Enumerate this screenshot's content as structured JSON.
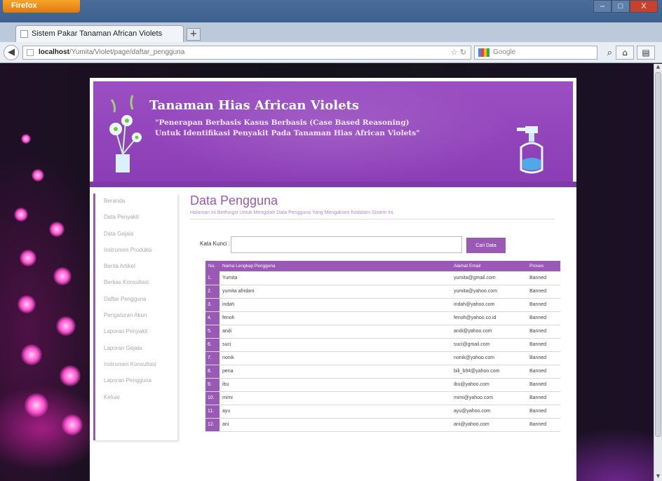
{
  "browser": {
    "app_button": "Firefox",
    "tab_title": "Sistem Pakar Tanaman African Violets",
    "new_tab": "+",
    "url_host": "localhost",
    "url_path": "/Yumita/Violet/page/daftar_pengguna",
    "search_placeholder": "Google",
    "window_min": "–",
    "window_max": "□",
    "window_close": "X"
  },
  "header": {
    "title": "Tanaman Hias African Violets",
    "subtitle_line1": "\"Penerapan Berbasis Kasus Berbasis (Case Based Reasoning)",
    "subtitle_line2": "Untuk Identifikasi Penyakit Pada Tanaman Hias African Violets\""
  },
  "sidebar": {
    "items": [
      {
        "label": "Beranda"
      },
      {
        "label": "Data Penyakit"
      },
      {
        "label": "Data Gejala"
      },
      {
        "label": "Instrumen Produksi"
      },
      {
        "label": "Berita Artikel"
      },
      {
        "label": "Berkas Konsultasi"
      },
      {
        "label": "Daftar Pengguna"
      },
      {
        "label": "Pengaturan Akun"
      },
      {
        "label": "Laporan Penyakit"
      },
      {
        "label": "Laporan Gejala"
      },
      {
        "label": "Instrumen Konsultasi"
      },
      {
        "label": "Laporan Pengguna"
      },
      {
        "label": "Keluar"
      }
    ]
  },
  "main": {
    "title": "Data Pengguna",
    "description": "Halaman ini Berfungsi Untuk Mengolah Data Pengguna Yang Mengakses Kedalam Sistem Ini.",
    "search_label": "Kata Kunci :",
    "search_value": "",
    "search_button": "Cari Data",
    "columns": [
      "No.",
      "Nama Lengkap Pengguna",
      "Alamat Email",
      "Proses"
    ],
    "rows": [
      {
        "no": "1.",
        "name": "Yumita",
        "email": "yumita@gmail.com",
        "action": "Banned"
      },
      {
        "no": "2.",
        "name": "yumita afridani",
        "email": "yumita@yahoo.com",
        "action": "Banned"
      },
      {
        "no": "3.",
        "name": "indah",
        "email": "indah@yahoo.com",
        "action": "Banned"
      },
      {
        "no": "4.",
        "name": "fenoh",
        "email": "fenoh@yahoo.co.id",
        "action": "Banned"
      },
      {
        "no": "5.",
        "name": "andi",
        "email": "andi@yahoo.com",
        "action": "Banned"
      },
      {
        "no": "6.",
        "name": "suci",
        "email": "suci@gmail.com",
        "action": "Banned"
      },
      {
        "no": "7.",
        "name": "nonik",
        "email": "nonik@yahoo.com",
        "action": "Banned"
      },
      {
        "no": "8.",
        "name": "pena",
        "email": "bili_b94@yahoo.com",
        "action": "Banned"
      },
      {
        "no": "9.",
        "name": "ibu",
        "email": "ibu@yahoo.com",
        "action": "Banned"
      },
      {
        "no": "10.",
        "name": "mimi",
        "email": "mimi@yahoo.com",
        "action": "Banned"
      },
      {
        "no": "11.",
        "name": "ayu",
        "email": "ayu@yahoo.com",
        "action": "Banned"
      },
      {
        "no": "12.",
        "name": "ani",
        "email": "ani@yahoo.com",
        "action": "Banned"
      }
    ]
  }
}
